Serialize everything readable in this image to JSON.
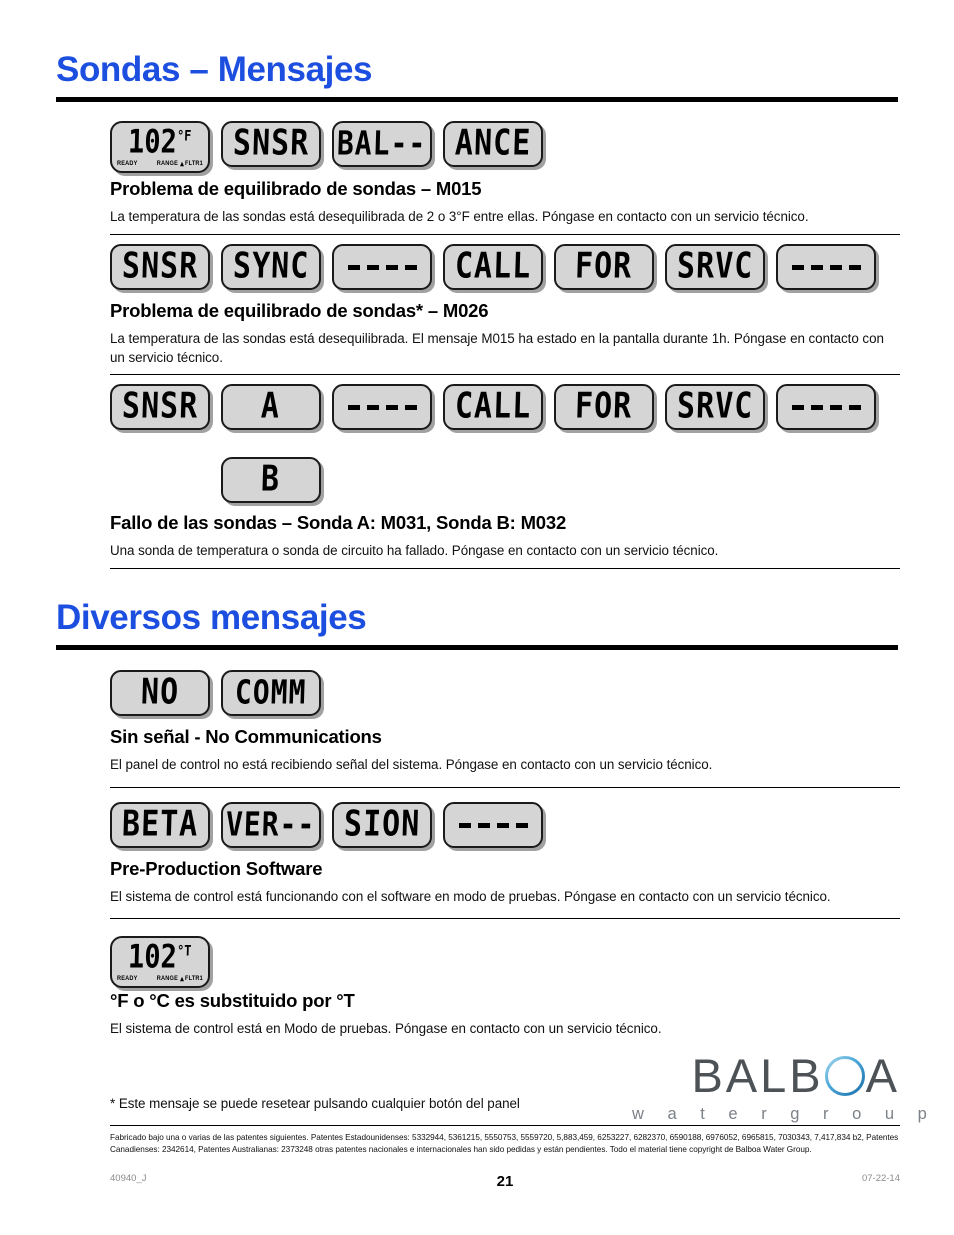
{
  "page": {
    "number": "21",
    "doc_code": "40940_J",
    "date": "07-22-14"
  },
  "sections": [
    {
      "title": "Sondas – Mensajes",
      "items": [
        {
          "displays": [
            {
              "type": "temp",
              "value": "102",
              "unit": "°F",
              "ready": "READY",
              "range": "RANGE",
              "filter": "FLTR1"
            },
            {
              "type": "text",
              "value": "SNSR"
            },
            {
              "type": "text",
              "value": "BAL--"
            },
            {
              "type": "text",
              "value": "ANCE"
            }
          ],
          "title": "Problema de equilibrado de sondas – M015",
          "desc": "La temperatura de las sondas está desequilibrada de 2 o 3°F entre ellas. Póngase en contacto con un servicio técnico."
        },
        {
          "displays": [
            {
              "type": "text",
              "value": "SNSR"
            },
            {
              "type": "text",
              "value": "SYNC"
            },
            {
              "type": "dashes",
              "value": "------"
            },
            {
              "type": "text",
              "value": "CALL"
            },
            {
              "type": "text",
              "value": "FOR"
            },
            {
              "type": "text",
              "value": "SRVC"
            },
            {
              "type": "dashes",
              "value": "------"
            }
          ],
          "title": "Problema de equilibrado de sondas* – M026",
          "desc": "La temperatura de las sondas está desequilibrada. El mensaje M015 ha estado en la pantalla durante 1h. Póngase en contacto con un servicio técnico."
        },
        {
          "displays": [
            {
              "type": "text",
              "value": "SNSR"
            },
            {
              "type": "text",
              "value": "A"
            },
            {
              "type": "dashes",
              "value": "------"
            },
            {
              "type": "text",
              "value": "CALL"
            },
            {
              "type": "text",
              "value": "FOR"
            },
            {
              "type": "text",
              "value": "SRVC"
            },
            {
              "type": "dashes",
              "value": "------"
            }
          ],
          "displays_row2": [
            {
              "type": "text",
              "value": "B"
            }
          ],
          "title": "Fallo de las sondas – Sonda A: M031, Sonda B: M032",
          "desc": "Una sonda de temperatura o sonda de circuito ha fallado. Póngase en contacto con un servicio técnico."
        }
      ]
    },
    {
      "title": "Diversos mensajes",
      "items": [
        {
          "displays": [
            {
              "type": "text",
              "value": "NO"
            },
            {
              "type": "text",
              "value": "COMM"
            }
          ],
          "title": "Sin señal - No Communications",
          "desc": "El panel de control no está recibiendo señal del sistema. Póngase en contacto con un servicio técnico."
        },
        {
          "displays": [
            {
              "type": "text",
              "value": "BETA"
            },
            {
              "type": "text",
              "value": "VER--"
            },
            {
              "type": "text",
              "value": "SION"
            },
            {
              "type": "dashes",
              "value": "------"
            }
          ],
          "title": "Pre-Production Software",
          "desc": "El sistema de control está funcionando con el software en modo de pruebas. Póngase en contacto con un servicio técnico."
        },
        {
          "displays": [
            {
              "type": "temp",
              "value": "102",
              "unit": "°T",
              "ready": "READY",
              "range": "RANGE",
              "filter": "FLTR1"
            }
          ],
          "title": "°F o °C es substituido por °T",
          "desc": "El sistema de control está en Modo de pruebas. Póngase en contacto con un servicio técnico."
        }
      ]
    }
  ],
  "footnote": "* Este mensaje se puede resetear pulsando cualquier botón del panel",
  "patents": "Fabricado bajo una o varias de las patentes siguientes. Patentes Estadounidenses: 5332944, 5361215, 5550753, 5559720, 5,883,459, 6253227, 6282370, 6590188, 6976052, 6965815, 7030343, 7,417,834 b2, Patentes Canadienses: 2342614, Patentes Australianas: 2373248 otras patentes nacionales e internacionales han sido pedidas y están pendientes. Todo el material tiene copyright de Balboa Water Group.",
  "logo": {
    "name_part1": "BALB",
    "name_part2": "A",
    "tagline": "w a t e r   g r o u p",
    "accent_color": "#3f9fd4",
    "text_color": "#4d5257"
  },
  "theme": {
    "heading_blue": "#1c4fe0",
    "lcd_bg": "#d5d5d5",
    "lcd_border": "#1a1a1a"
  }
}
